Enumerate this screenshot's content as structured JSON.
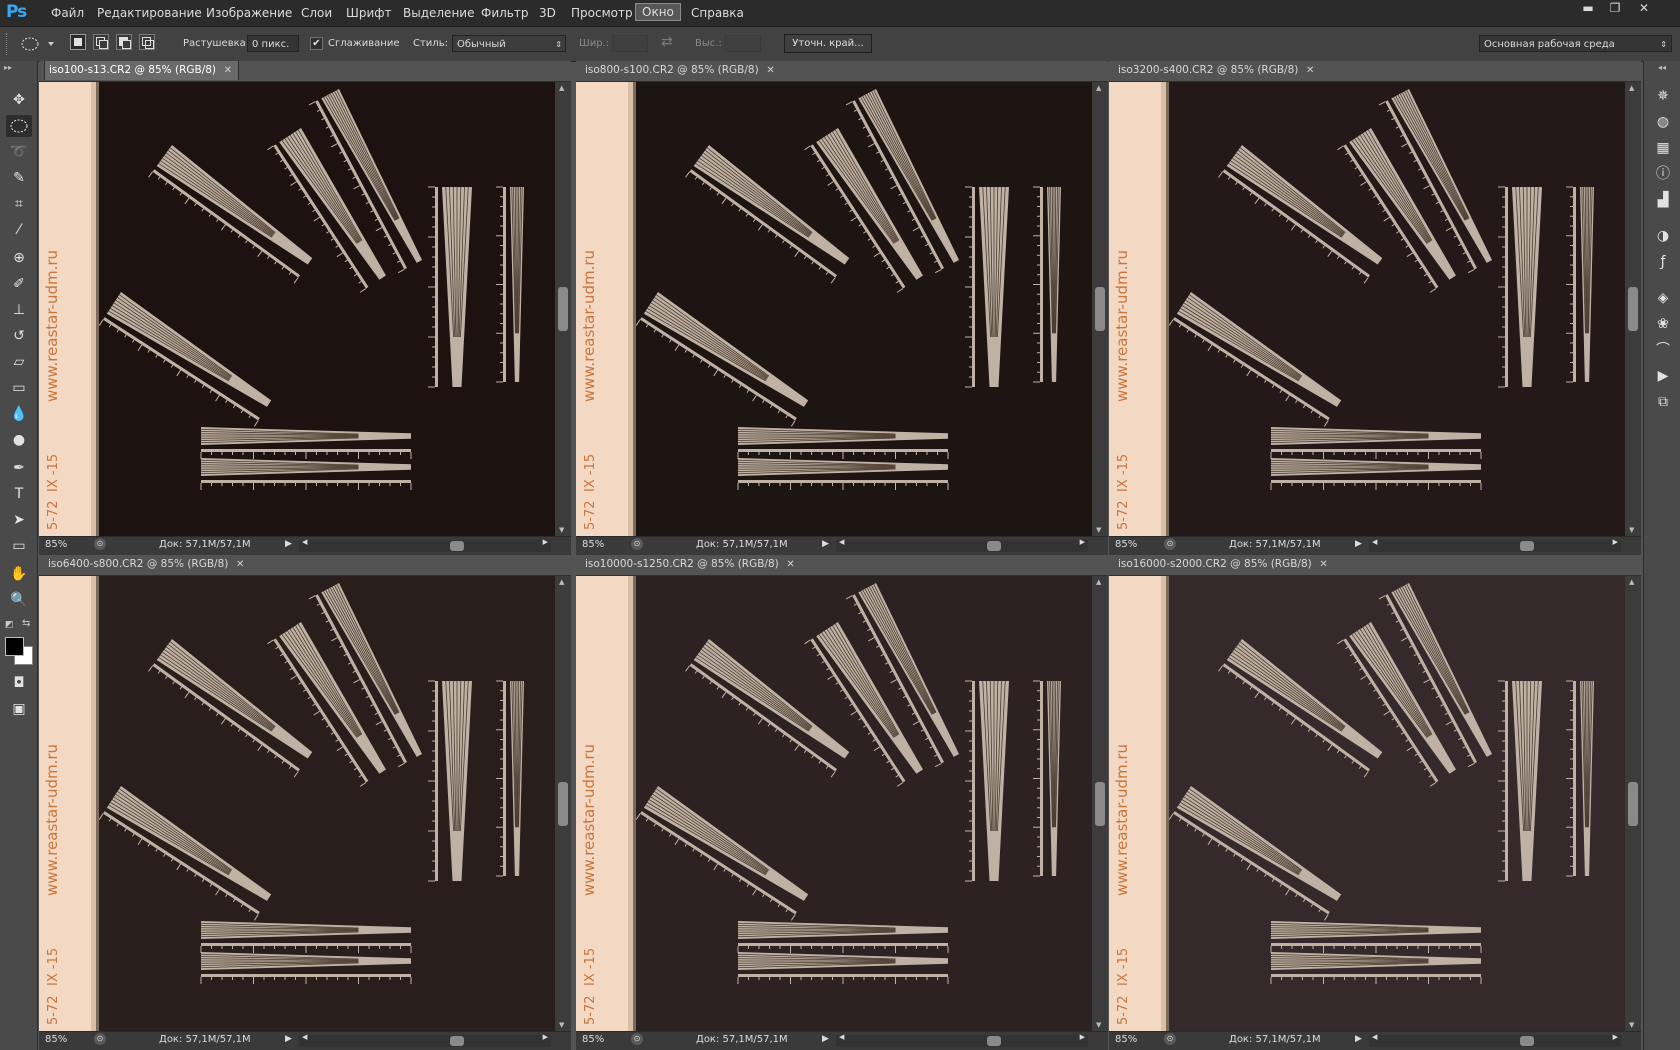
{
  "app": {
    "logo": "Ps"
  },
  "menu": [
    {
      "label": "Файл",
      "active": false
    },
    {
      "label": "Редактирование",
      "active": false
    },
    {
      "label": "Изображение",
      "active": false
    },
    {
      "label": "Слои",
      "active": false
    },
    {
      "label": "Шрифт",
      "active": false
    },
    {
      "label": "Выделение",
      "active": false
    },
    {
      "label": "Фильтр",
      "active": false
    },
    {
      "label": "3D",
      "active": false
    },
    {
      "label": "Просмотр",
      "active": false
    },
    {
      "label": "Окно",
      "active": true
    },
    {
      "label": "Справка",
      "active": false
    }
  ],
  "window_buttons": {
    "minimize": "▬",
    "restore": "❐",
    "close": "✕"
  },
  "options": {
    "feather_label": "Растушевка:",
    "feather_value": "0 пикс.",
    "antialias_label": "Сглаживание",
    "antialias_checked": true,
    "style_label": "Стиль:",
    "style_value": "Обычный",
    "width_label": "Шир.:",
    "height_label": "Выс.:",
    "refine_button": "Уточн. край...",
    "workspace": "Основная рабочая среда"
  },
  "tools": [
    "move-tool",
    "elliptical-marquee-tool",
    "lasso-tool",
    "quick-selection-tool",
    "crop-tool",
    "eyedropper-tool",
    "spot-healing-tool",
    "brush-tool",
    "clone-stamp-tool",
    "history-brush-tool",
    "eraser-tool",
    "gradient-tool",
    "blur-tool",
    "dodge-tool",
    "pen-tool",
    "type-tool",
    "path-selection-tool",
    "rectangle-tool",
    "hand-tool",
    "zoom-tool"
  ],
  "colors": {
    "foreground": "#000000",
    "background": "#ffffff",
    "accent": "#3ba6f5"
  },
  "documents": [
    {
      "title": "iso100-s13.CR2 @ 85% (RGB/8)",
      "zoom": "85%",
      "doc_size": "Док: 57,1M/57,1M",
      "active": true,
      "bg": "#1c120f"
    },
    {
      "title": "iso800-s100.CR2 @ 85% (RGB/8)",
      "zoom": "85%",
      "doc_size": "Док: 57,1M/57,1M",
      "active": false,
      "bg": "#1a110e"
    },
    {
      "title": "iso3200-s400.CR2 @ 85% (RGB/8)",
      "zoom": "85%",
      "doc_size": "Док: 57,1M/57,1M",
      "active": false,
      "bg": "#1b1211"
    },
    {
      "title": "iso6400-s800.CR2 @ 85% (RGB/8)",
      "zoom": "85%",
      "doc_size": "Док: 57,1M/57,1M",
      "active": false,
      "bg": "#1d1512"
    },
    {
      "title": "iso10000-s1250.CR2 @ 85% (RGB/8)",
      "zoom": "85%",
      "doc_size": "Док: 57,1M/57,1M",
      "active": false,
      "bg": "#1e1514"
    },
    {
      "title": "iso16000-s2000.CR2 @ 85% (RGB/8)",
      "zoom": "85%",
      "doc_size": "Док: 57,1M/57,1M",
      "active": false,
      "bg": "#221a1b"
    }
  ],
  "image_text": {
    "url": "www.reastar-udm.ru",
    "mark1": "IX -15",
    "mark2": "5-72"
  }
}
